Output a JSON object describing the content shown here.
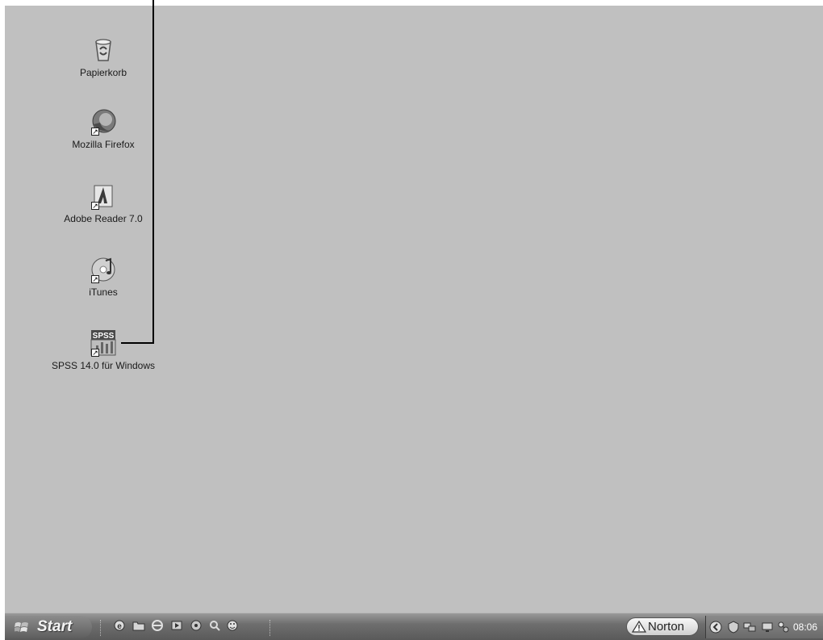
{
  "desktop": {
    "icons": [
      {
        "label": "Papierkorb",
        "icon": "recycle-bin-icon"
      },
      {
        "label": "Mozilla Firefox",
        "icon": "firefox-icon"
      },
      {
        "label": "Adobe Reader 7.0",
        "icon": "adobe-reader-icon"
      },
      {
        "label": "iTunes",
        "icon": "itunes-icon"
      },
      {
        "label": "SPSS 14.0 für Windows",
        "icon": "spss-icon",
        "icon_text": "SPSS"
      }
    ]
  },
  "taskbar": {
    "start_label": "Start",
    "quick_launch": [
      "internet-explorer-icon",
      "folder-icon",
      "browser-icon",
      "media-icon",
      "network-icon",
      "search-icon",
      "smiley-icon"
    ],
    "norton_label": "Norton",
    "tray_icons": [
      "expand-tray-icon",
      "security-icon",
      "network-icon",
      "monitor-icon",
      "connection-icon"
    ],
    "clock": "08:06"
  }
}
